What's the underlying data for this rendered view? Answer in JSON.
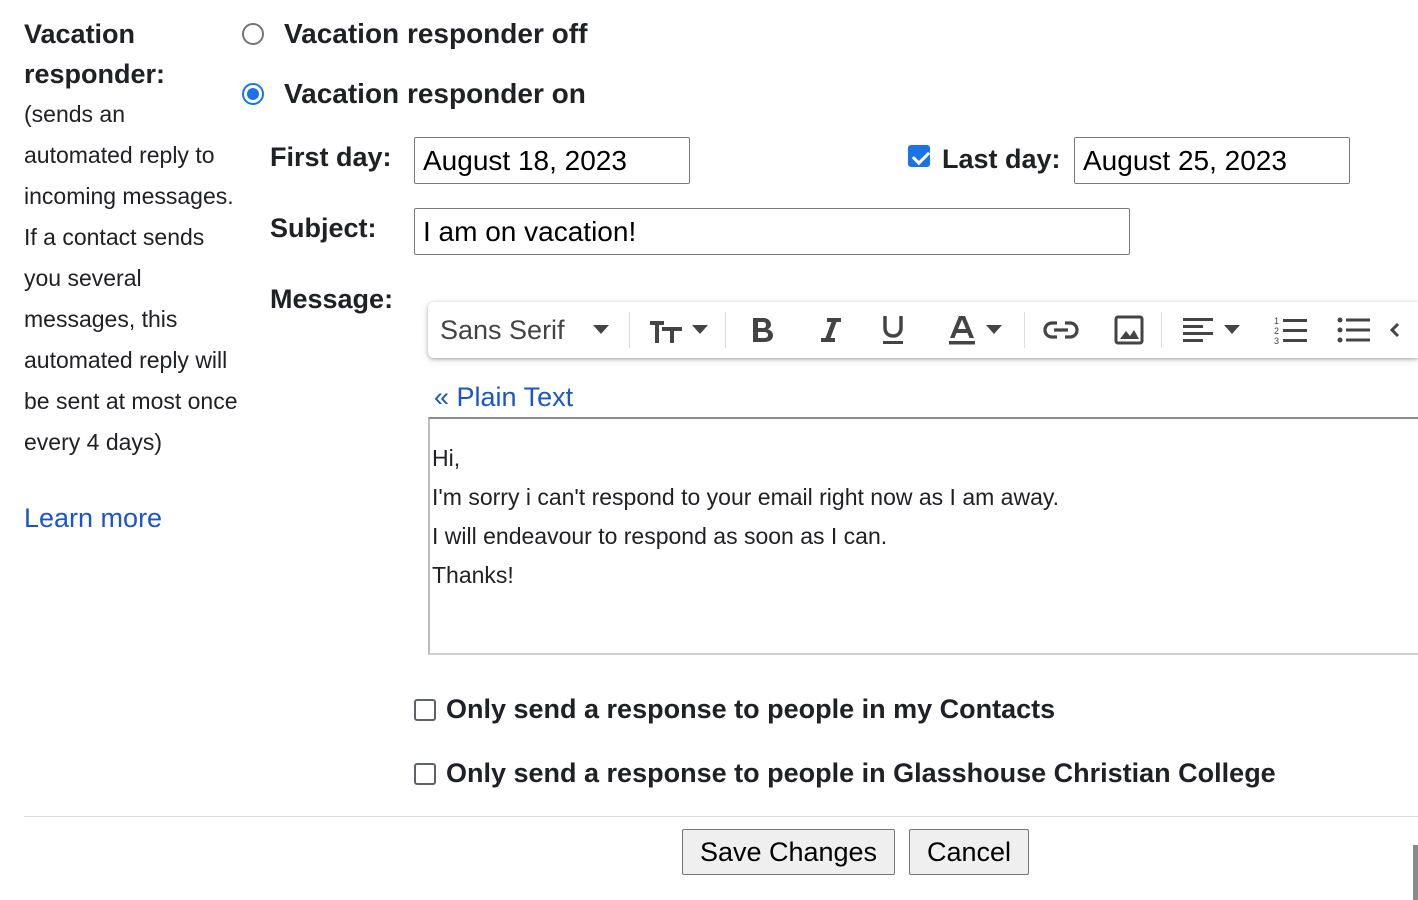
{
  "section": {
    "title": "Vacation responder:",
    "description": "(sends an automated reply to incoming messages. If a contact sends you several messages, this automated reply will be sent at most once every 4 days)",
    "learn_more": "Learn more"
  },
  "responder": {
    "off_label": "Vacation responder off",
    "on_label": "Vacation responder on",
    "selected": "on"
  },
  "dates": {
    "first_day_label": "First day:",
    "first_day_value": "August 18, 2023",
    "last_day_label": "Last day:",
    "last_day_value": "August 25, 2023",
    "last_day_enabled": true
  },
  "subject": {
    "label": "Subject:",
    "value": "I am on vacation!"
  },
  "message": {
    "label": "Message:",
    "toolbar": {
      "font": "Sans Serif",
      "icons": [
        "text-size-icon",
        "bold-icon",
        "italic-icon",
        "underline-icon",
        "text-color-icon",
        "link-icon",
        "image-icon",
        "align-icon",
        "numbered-list-icon",
        "bulleted-list-icon",
        "indent-less-icon"
      ]
    },
    "plain_text_link": "« Plain Text",
    "body_lines": [
      "Hi,",
      "I'm sorry i can't respond to your email right now as I am away.",
      "I will endeavour to respond as soon as I can.",
      "Thanks!"
    ]
  },
  "options": {
    "contacts_only": "Only send a response to people in my Contacts",
    "org_only": "Only send a response to people in Glasshouse Christian College"
  },
  "actions": {
    "save": "Save Changes",
    "cancel": "Cancel"
  },
  "colors": {
    "accent": "#1a73e8",
    "link": "#1a56c8"
  }
}
